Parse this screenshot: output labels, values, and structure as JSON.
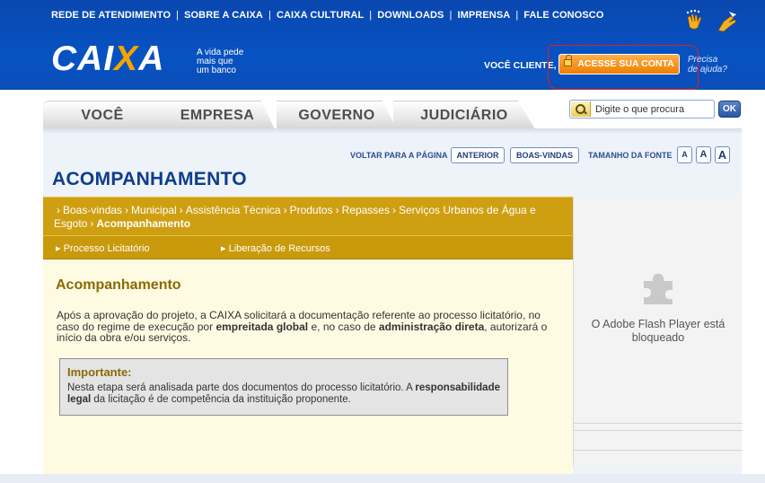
{
  "header": {
    "nav_links": [
      "REDE DE ATENDIMENTO",
      "SOBRE A CAIXA",
      "CAIXA CULTURAL",
      "DOWNLOADS",
      "IMPRENSA",
      "FALE CONOSCO"
    ],
    "nav_separator": "|",
    "logo": {
      "pre": "CAI",
      "x": "X",
      "post": "A"
    },
    "tagline": [
      "A vida pede",
      "mais que",
      "um banco"
    ],
    "client_label": "VOCÊ CLIENTE,",
    "account_button": "ACESSE SUA CONTA",
    "help_link": [
      "Precisa",
      "de ajuda?"
    ],
    "accessibility_icons": [
      "sign-language-hand-icon",
      "pointer-hand-icon"
    ]
  },
  "tabs": [
    "VOCÊ",
    "EMPRESA",
    "GOVERNO",
    "JUDICIÁRIO"
  ],
  "search": {
    "placeholder": "Digite o que procura",
    "submit_label": "OK"
  },
  "tools": {
    "back_label": "VOLTAR PARA A PÁGINA",
    "previous_button": "ANTERIOR",
    "welcome_button": "BOAS-VINDAS",
    "font_size_label": "TAMANHO DA FONTE",
    "font_buttons": [
      "A",
      "A",
      "A"
    ]
  },
  "page_title": "ACOMPANHAMENTO",
  "breadcrumb": {
    "items": [
      "Boas-vindas",
      "Municipal",
      "Assistência Técnica",
      "Produtos",
      "Repasses",
      "Serviços Urbanos de Água e Esgoto"
    ],
    "current": "Acompanhamento",
    "separator": "›"
  },
  "sub_links": [
    "Processo Licitatório",
    "Liberação de Recursos"
  ],
  "content": {
    "title": "Acompanhamento",
    "p1_a": "Após a aprovação do projeto, a CAIXA solicitará a documentação referente ao processo licitatório, no caso do regime de execução por ",
    "p1_bold1": "empreitada global",
    "p1_b": " e, no caso de ",
    "p1_bold2": "administração direta",
    "p1_c": ", autorizará o início da obra e/ou serviços.",
    "notice_title": "Importante:",
    "notice_a": "Nesta etapa será analisada parte dos documentos do processo licitatório. A ",
    "notice_bold": "responsabilidade legal",
    "notice_b": " da licitação é de competência da instituição proponente."
  },
  "flash": {
    "message": "O Adobe Flash Player está bloqueado"
  },
  "colors": {
    "header_blue": "#0752c2",
    "caixa_orange": "#f7a400",
    "account_button_orange": "#f07d00",
    "breadcrumb_gold": "#cf9f12",
    "content_cream": "#fffbe2",
    "title_navy": "#0d3d8c",
    "annotation_red": "#e0201a"
  }
}
